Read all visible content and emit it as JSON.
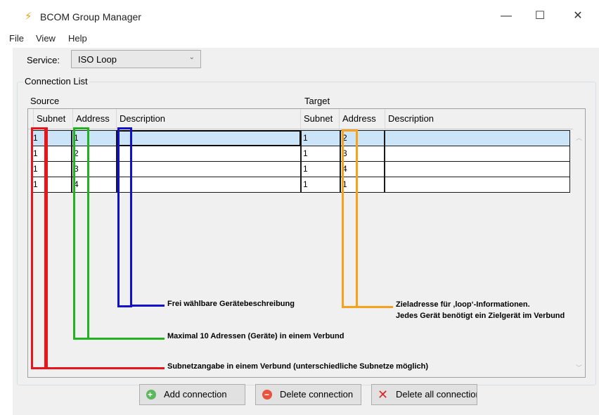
{
  "window": {
    "title": "BCOM Group Manager",
    "controls": {
      "minimize": "—",
      "maximize": "☐",
      "close": "✕"
    }
  },
  "menu": [
    "File",
    "View",
    "Help"
  ],
  "service": {
    "label": "Service:",
    "value": "ISO Loop"
  },
  "connection_list": {
    "legend": "Connection List",
    "source_label": "Source",
    "target_label": "Target",
    "columns": [
      "Subnet",
      "Address",
      "Description",
      "Subnet",
      "Address",
      "Description"
    ],
    "rows": [
      {
        "src_subnet": "1",
        "src_address": "1",
        "src_description": "",
        "tgt_subnet": "1",
        "tgt_address": "2",
        "tgt_description": ""
      },
      {
        "src_subnet": "1",
        "src_address": "2",
        "src_description": "",
        "tgt_subnet": "1",
        "tgt_address": "3",
        "tgt_description": ""
      },
      {
        "src_subnet": "1",
        "src_address": "3",
        "src_description": "",
        "tgt_subnet": "1",
        "tgt_address": "4",
        "tgt_description": ""
      },
      {
        "src_subnet": "1",
        "src_address": "4",
        "src_description": "",
        "tgt_subnet": "1",
        "tgt_address": "1",
        "tgt_description": ""
      }
    ],
    "selected_row": 0
  },
  "annotations": {
    "description": "Frei wählbare Gerätebeschreibung",
    "address": "Maximal 10 Adressen (Geräte) in einem Verbund",
    "subnet": "Subnetzangabe in einem Verbund (unterschiedliche Subnetze möglich)",
    "target_line1": "Zieladresse für ‚loop‘-Informationen.",
    "target_line2": "Jedes Gerät benötigt ein Zielgerät im Verbund"
  },
  "annotation_colors": {
    "subnet": "#e8161b",
    "address": "#22b21f",
    "description": "#1010cc",
    "target": "#f7a11c"
  },
  "buttons": {
    "add": "Add connection",
    "delete": "Delete connection",
    "delete_all": "Delete all connections"
  },
  "icons": {
    "app": "lightning-icon",
    "add": "plus-circle-icon",
    "delete": "minus-circle-icon",
    "delete_all": "red-x-icon"
  }
}
